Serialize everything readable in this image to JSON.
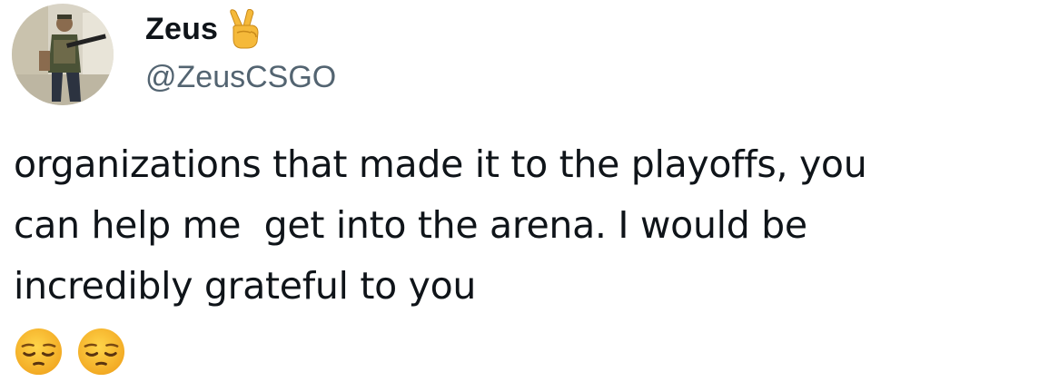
{
  "tweet": {
    "author": {
      "display_name": "Zeus",
      "name_emoji": "victory-hand-emoji",
      "handle": "@ZeusCSGO",
      "avatar_icon": "profile-photo"
    },
    "text_lines": [
      "organizations that made it to the playoffs, you",
      "can help me  get into the arena. I would be",
      "incredibly grateful to you"
    ],
    "emojis": [
      "pensive-face-emoji",
      "pensive-face-emoji"
    ]
  },
  "colors": {
    "text": "#0f1419",
    "handle": "#536471",
    "background": "#ffffff",
    "emoji_yellow": "#f5b93a"
  }
}
